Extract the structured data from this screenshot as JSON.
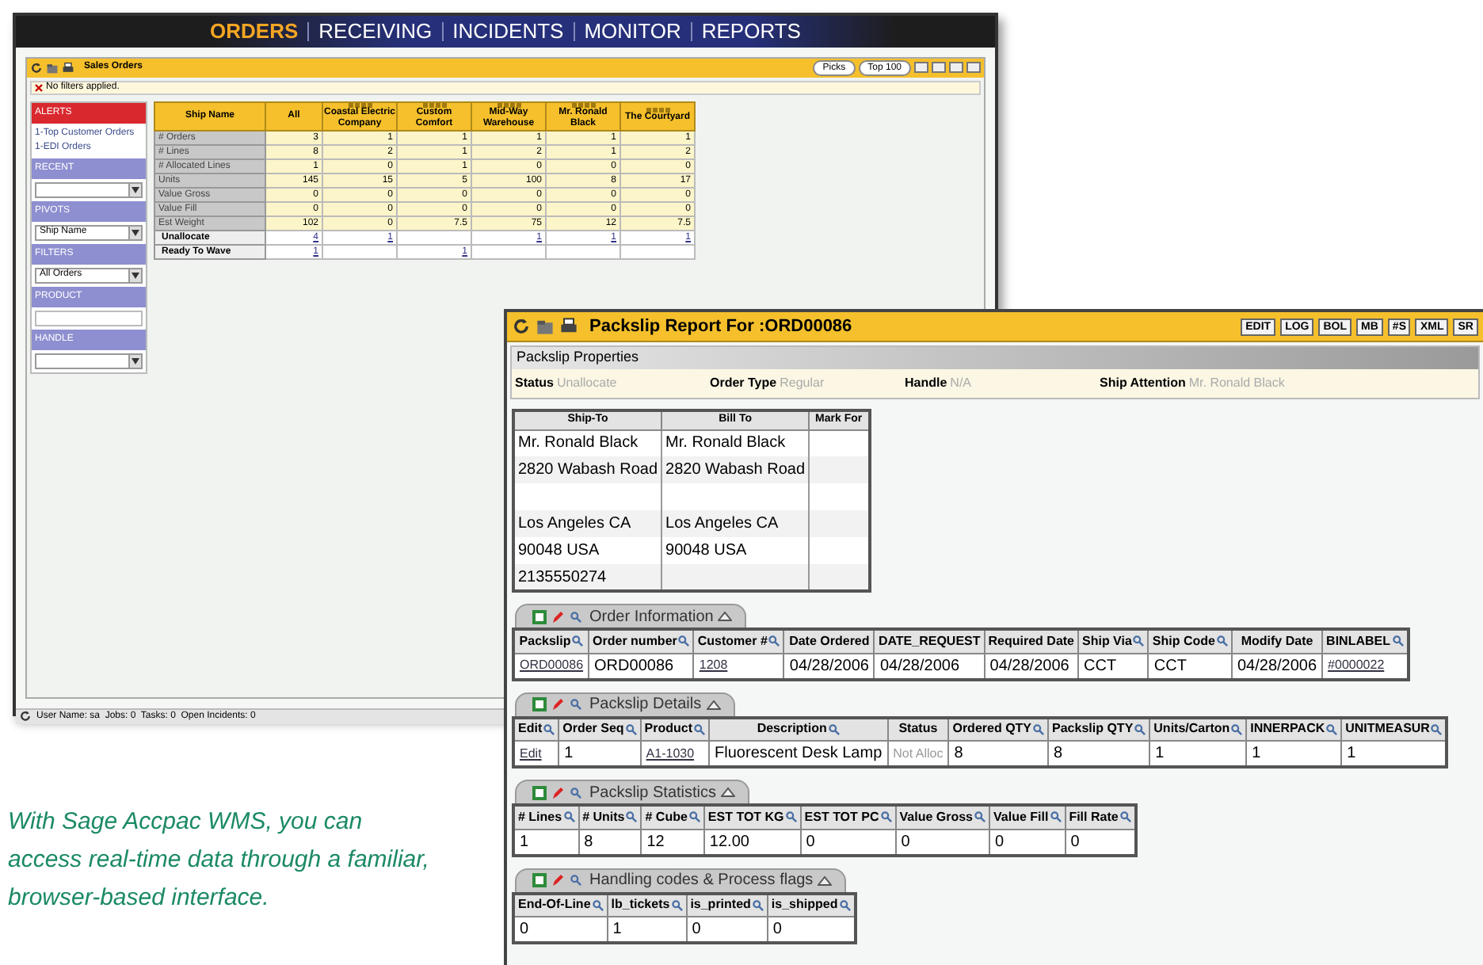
{
  "nav": [
    {
      "label": "ORDERS",
      "selected": true
    },
    {
      "label": "RECEIVING",
      "selected": false
    },
    {
      "label": "INCIDENTS",
      "selected": false
    },
    {
      "label": "MONITOR",
      "selected": false
    },
    {
      "label": "REPORTS",
      "selected": false
    }
  ],
  "sales_orders": {
    "title": "Sales Orders",
    "buttons": [
      "Picks",
      "Top 100"
    ],
    "filter_note": "No filters applied.",
    "sidebar": [
      {
        "kind": "list",
        "heading": "ALERTS",
        "items": [
          "1-Top Customer Orders",
          "1-EDI Orders"
        ]
      },
      {
        "kind": "select",
        "heading": "RECENT"
      },
      {
        "kind": "select",
        "heading": "PIVOTS",
        "value": "Ship Name"
      },
      {
        "kind": "select",
        "heading": "FILTERS",
        "value": "All Orders"
      },
      {
        "kind": "input",
        "heading": "PRODUCT"
      },
      {
        "kind": "select",
        "heading": "HANDLE"
      }
    ],
    "pivot": {
      "columns": [
        "Ship Name",
        "All",
        "Coastal Electric Company",
        "Custom Comfort",
        "Mid-Way Warehouse",
        "Mr. Ronald Black",
        "The Courtyard"
      ],
      "rows": [
        {
          "kind": "metric",
          "cells": [
            "# Orders",
            "3",
            "1",
            "1",
            "1",
            "1",
            "1"
          ]
        },
        {
          "kind": "metric",
          "cells": [
            "# Lines",
            "8",
            "2",
            "1",
            "2",
            "1",
            "2"
          ]
        },
        {
          "kind": "metric",
          "cells": [
            "# Allocated Lines",
            "1",
            "0",
            "1",
            "0",
            "0",
            "0"
          ]
        },
        {
          "kind": "metric",
          "cells": [
            "Units",
            "145",
            "15",
            "5",
            "100",
            "8",
            "17"
          ]
        },
        {
          "kind": "metric",
          "cells": [
            "Value Gross",
            "0",
            "0",
            "0",
            "0",
            "0",
            "0"
          ]
        },
        {
          "kind": "metric",
          "cells": [
            "Value Fill",
            "0",
            "0",
            "0",
            "0",
            "0",
            "0"
          ]
        },
        {
          "kind": "metric",
          "cells": [
            "Est Weight",
            "102",
            "0",
            "7.5",
            "75",
            "12",
            "7.5"
          ]
        },
        {
          "kind": "action",
          "cells": [
            "Unallocate",
            "4",
            "1",
            null,
            "1",
            "1",
            "1"
          ]
        },
        {
          "kind": "action",
          "cells": [
            "Ready To Wave",
            "1",
            null,
            "1",
            null,
            null,
            null
          ]
        }
      ]
    },
    "status_bar": "User Name: sa  Jobs: 0  Tasks: 0  Open Incidents: 0"
  },
  "packslip": {
    "title": "Packslip Report For :ORD00086",
    "buttons": [
      "EDIT",
      "LOG",
      "BOL",
      "MB",
      "#S",
      "XML",
      "SR"
    ],
    "properties_heading": "Packslip Properties",
    "properties": [
      {
        "label": "Status",
        "value": "Unallocate"
      },
      {
        "label": "Order Type",
        "value": "Regular"
      },
      {
        "label": "Handle",
        "value": "N/A"
      },
      {
        "label": "Ship Attention",
        "value": "Mr. Ronald Black"
      }
    ],
    "address": {
      "columns": [
        "Ship-To",
        "Bill To",
        "Mark For"
      ],
      "rows": [
        [
          "Mr. Ronald Black",
          "Mr. Ronald Black",
          null
        ],
        [
          "2820 Wabash Road",
          "2820 Wabash Road",
          null
        ],
        [
          null,
          null,
          null
        ],
        [
          "Los Angeles CA",
          "Los Angeles CA",
          null
        ],
        [
          "90048 USA",
          "90048 USA",
          null
        ],
        [
          "2135550274",
          null,
          null
        ]
      ]
    },
    "sections": [
      {
        "title": "Order Information",
        "columns": [
          {
            "label": "Packslip",
            "filter": true
          },
          {
            "label": "Order number",
            "filter": true
          },
          {
            "label": "Customer #",
            "filter": true
          },
          {
            "label": "Date Ordered",
            "filter": false
          },
          {
            "label": "DATE_REQUEST",
            "filter": false
          },
          {
            "label": "Required Date",
            "filter": false
          },
          {
            "label": "Ship Via",
            "filter": true
          },
          {
            "label": "Ship Code",
            "filter": true
          },
          {
            "label": "Modify Date",
            "filter": false
          },
          {
            "label": "BINLABEL",
            "filter": true
          }
        ],
        "row": [
          {
            "text": "ORD00086",
            "link": true
          },
          {
            "text": "ORD00086",
            "link": false
          },
          {
            "text": "1208",
            "link": true
          },
          {
            "text": "04/28/2006",
            "link": false
          },
          {
            "text": "04/28/2006",
            "link": false
          },
          {
            "text": "04/28/2006",
            "link": false
          },
          {
            "text": "CCT",
            "link": false
          },
          {
            "text": "CCT",
            "link": false
          },
          {
            "text": "04/28/2006",
            "link": false
          },
          {
            "text": "#0000022",
            "link": true
          }
        ]
      },
      {
        "title": "Packslip Details",
        "columns": [
          {
            "label": "Edit",
            "filter": true
          },
          {
            "label": "Order Seq",
            "filter": true
          },
          {
            "label": "Product",
            "filter": true
          },
          {
            "label": "Description",
            "filter": true
          },
          {
            "label": "Status",
            "filter": false
          },
          {
            "label": "Ordered QTY",
            "filter": true
          },
          {
            "label": "Packslip QTY",
            "filter": true
          },
          {
            "label": "Units/Carton",
            "filter": true
          },
          {
            "label": "INNERPACK",
            "filter": true
          },
          {
            "label": "UNITMEASUR",
            "filter": true
          }
        ],
        "row": [
          {
            "text": "Edit",
            "link": true
          },
          {
            "text": "1",
            "link": false
          },
          {
            "text": "A1-1030",
            "link": true
          },
          {
            "text": "Fluorescent Desk Lamp",
            "link": false
          },
          {
            "text": "Not Alloc",
            "link": false,
            "muted": true
          },
          {
            "text": "8",
            "link": false
          },
          {
            "text": "8",
            "link": false
          },
          {
            "text": "1",
            "link": false
          },
          {
            "text": "1",
            "link": false
          },
          {
            "text": "1",
            "link": false
          }
        ]
      },
      {
        "title": "Packslip Statistics",
        "columns": [
          {
            "label": "# Lines",
            "filter": true
          },
          {
            "label": "# Units",
            "filter": true
          },
          {
            "label": "# Cube",
            "filter": true
          },
          {
            "label": "EST TOT KG",
            "filter": true
          },
          {
            "label": "EST TOT PC",
            "filter": true
          },
          {
            "label": "Value Gross",
            "filter": true
          },
          {
            "label": "Value Fill",
            "filter": true
          },
          {
            "label": "Fill Rate",
            "filter": true
          }
        ],
        "row": [
          {
            "text": "1",
            "link": false
          },
          {
            "text": "8",
            "link": false
          },
          {
            "text": "12",
            "link": false
          },
          {
            "text": "12.00",
            "link": false
          },
          {
            "text": "0",
            "link": false
          },
          {
            "text": "0",
            "link": false
          },
          {
            "text": "0",
            "link": false
          },
          {
            "text": "0",
            "link": false
          }
        ]
      },
      {
        "title": "Handling codes & Process flags",
        "columns": [
          {
            "label": "End-Of-Line",
            "filter": true
          },
          {
            "label": "lb_tickets",
            "filter": true
          },
          {
            "label": "is_printed",
            "filter": true
          },
          {
            "label": "is_shipped",
            "filter": true
          }
        ],
        "row": [
          {
            "text": "0",
            "link": false
          },
          {
            "text": "1",
            "link": false
          },
          {
            "text": "0",
            "link": false
          },
          {
            "text": "0",
            "link": false
          }
        ]
      }
    ]
  },
  "caption": "With Sage Accpac WMS, you can access real-time data through a familiar, browser-based interface."
}
